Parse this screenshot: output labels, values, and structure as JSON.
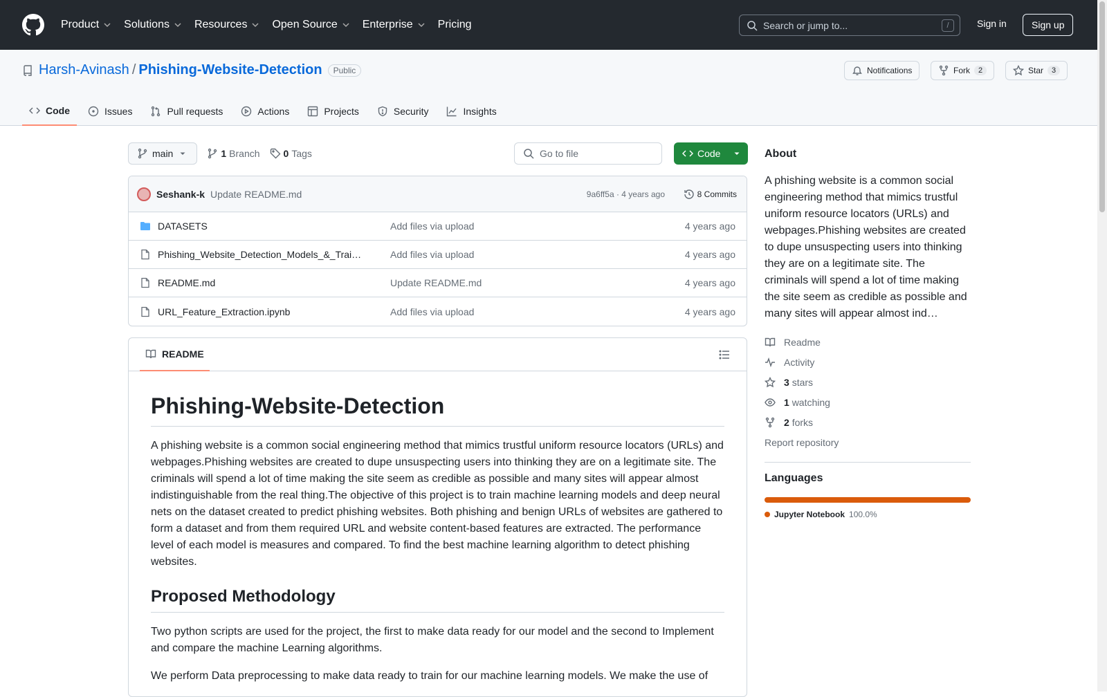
{
  "header": {
    "nav": [
      "Product",
      "Solutions",
      "Resources",
      "Open Source",
      "Enterprise",
      "Pricing"
    ],
    "search_placeholder": "Search or jump to...",
    "slash": "/",
    "signin": "Sign in",
    "signup": "Sign up"
  },
  "repo": {
    "owner": "Harsh-Avinash",
    "name": "Phishing-Website-Detection",
    "visibility": "Public",
    "notifications": "Notifications",
    "fork": "Fork",
    "fork_count": "2",
    "star": "Star",
    "star_count": "3"
  },
  "tabs": [
    "Code",
    "Issues",
    "Pull requests",
    "Actions",
    "Projects",
    "Security",
    "Insights"
  ],
  "toolbar": {
    "branch": "main",
    "branch_count": "1",
    "branch_label": "Branch",
    "tag_count": "0",
    "tag_label": "Tags",
    "goto": "Go to file",
    "code": "Code"
  },
  "commit": {
    "author": "Seshank-k",
    "message": "Update README.md",
    "hash": "9a6ff5a · 4 years ago",
    "commits": "8 Commits"
  },
  "files": [
    {
      "name": "DATASETS",
      "message": "Add files via upload",
      "date": "4 years ago",
      "type": "folder"
    },
    {
      "name": "Phishing_Website_Detection_Models_&_Trai…",
      "message": "Add files via upload",
      "date": "4 years ago",
      "type": "file"
    },
    {
      "name": "README.md",
      "message": "Update README.md",
      "date": "4 years ago",
      "type": "file"
    },
    {
      "name": "URL_Feature_Extraction.ipynb",
      "message": "Add files via upload",
      "date": "4 years ago",
      "type": "file"
    }
  ],
  "readme": {
    "tab": "README",
    "h1": "Phishing-Website-Detection",
    "p1": "A phishing website is a common social engineering method that mimics trustful uniform resource locators (URLs) and webpages.Phishing websites are created to dupe unsuspecting users into thinking they are on a legitimate site. The criminals will spend a lot of time making the site seem as credible as possible and many sites will appear almost indistinguishable from the real thing.The objective of this project is to train machine learning models and deep neural nets on the dataset created to predict phishing websites. Both phishing and benign URLs of websites are gathered to form a dataset and from them required URL and website content-based features are extracted. The performance level of each model is measures and compared. To find the best machine learning algorithm to detect phishing websites.",
    "h2": "Proposed Methodology",
    "p2": "Two python scripts are used for the project, the first to make data ready for our model and the second to Implement and compare the machine Learning algorithms.",
    "p3": "We perform Data preprocessing to make data ready to train for our machine learning models. We make the use of"
  },
  "about": {
    "title": "About",
    "text": "A phishing website is a common social engineering method that mimics trustful uniform resource locators (URLs) and webpages.Phishing websites are created to dupe unsuspecting users into thinking they are on a legitimate site. The criminals will spend a lot of time making the site seem as credible as possible and many sites will appear almost ind…",
    "readme": "Readme",
    "activity": "Activity",
    "stars_n": "3",
    "stars": "stars",
    "watching_n": "1",
    "watching": "watching",
    "forks_n": "2",
    "forks": "forks",
    "report": "Report repository"
  },
  "languages": {
    "title": "Languages",
    "name": "Jupyter Notebook",
    "pct": "100.0%",
    "color": "#DA5B0B"
  }
}
